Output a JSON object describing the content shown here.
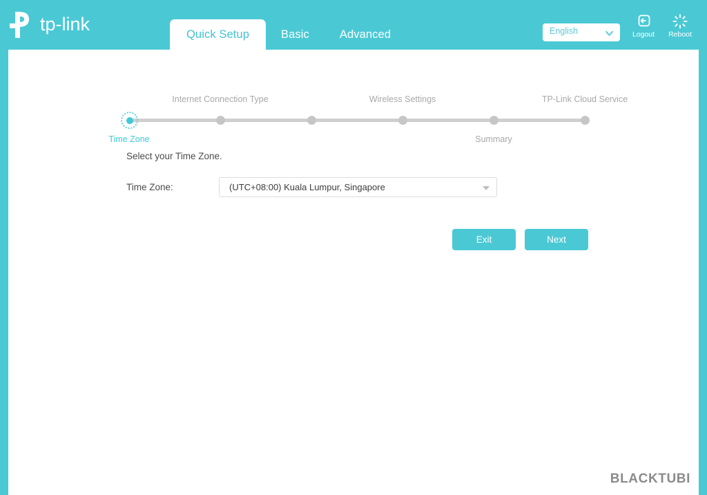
{
  "brand": {
    "name": "tp-link",
    "logo_icon": "tp-link-logo"
  },
  "header": {
    "tabs": [
      {
        "label": "Quick Setup",
        "active": true
      },
      {
        "label": "Basic",
        "active": false
      },
      {
        "label": "Advanced",
        "active": false
      }
    ],
    "language": {
      "selected": "English",
      "chevron_icon": "chevron-down-icon"
    },
    "logout": {
      "label": "Logout",
      "icon": "logout-icon"
    },
    "reboot": {
      "label": "Reboot",
      "icon": "reboot-icon"
    },
    "accent_color": "#4ac9d5"
  },
  "stepper": {
    "steps": [
      {
        "label": "Time Zone",
        "position": "below",
        "state": "current"
      },
      {
        "label": "Internet Connection Type",
        "position": "above",
        "state": "pending"
      },
      {
        "label": "Wireless Settings",
        "position": "above",
        "state": "pending"
      },
      {
        "label": "Summary",
        "position": "below",
        "state": "pending"
      },
      {
        "label": "TP-Link Cloud Service",
        "position": "above",
        "state": "pending"
      },
      {
        "label": "",
        "position": "above",
        "state": "pending"
      }
    ]
  },
  "main": {
    "intro_text": "Select your Time Zone.",
    "time_zone_field": {
      "label": "Time Zone:",
      "value": "(UTC+08:00) Kuala Lumpur, Singapore",
      "arrow_icon": "triangle-down-icon"
    },
    "buttons": {
      "exit": "Exit",
      "next": "Next"
    }
  },
  "watermark": {
    "text": "BLACKTUBI"
  }
}
